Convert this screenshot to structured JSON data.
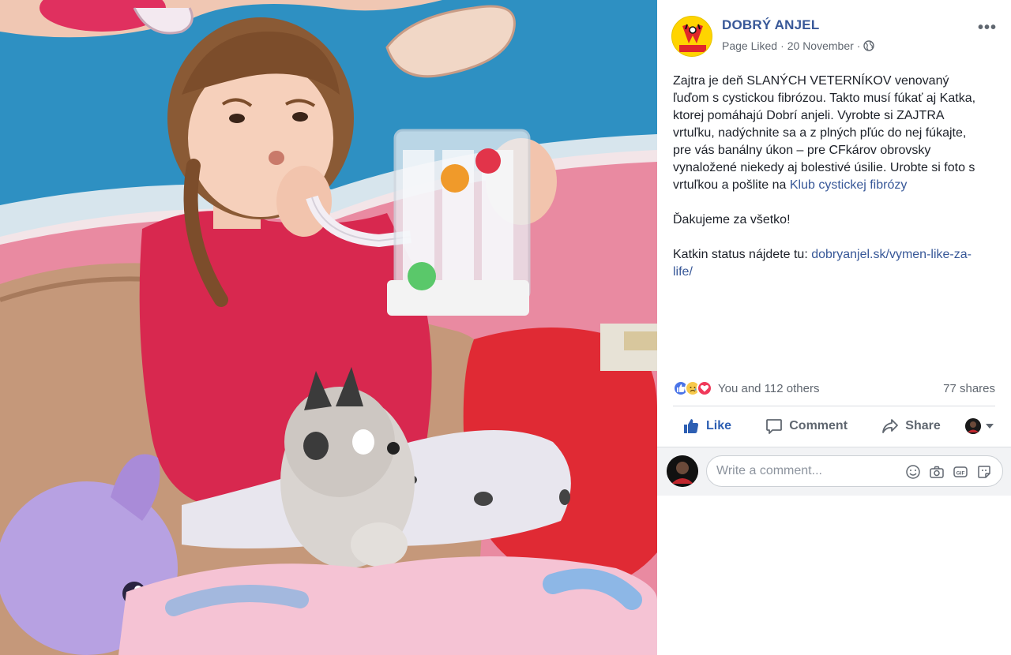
{
  "post": {
    "page_name": "DOBRÝ ANJEL",
    "page_logo_text": "DOBRÝ ANJEL",
    "status": "Page Liked",
    "separator": "·",
    "date": "20 November",
    "more_label": "•••",
    "paragraphs": [
      {
        "text": "Zajtra je deň SLANÝCH VETERNÍKOV venovaný ľuďom s cystickou fibrózou. Takto musí fúkať aj Katka, ktorej pomáhajú Dobrí anjeli. Vyrobte si ZAJTRA vrtuľku, nadýchnite sa a z plných pľúc do nej fúkajte, pre vás banálny úkon – pre CFkárov obrovsky vynaložené niekedy aj bolestivé úsilie. Urobte si foto s vrtuľkou a pošlite na ",
        "link": "Klub cystickej fibrózy"
      },
      {
        "text": "Ďakujeme za všetko!"
      },
      {
        "text": "Katkin status nájdete tu: ",
        "link": "dobryanjel.sk/vymen-like-za-life/"
      }
    ]
  },
  "reactions": {
    "icons": [
      "like-reaction-icon",
      "sad-reaction-icon",
      "love-reaction-icon"
    ],
    "count_text": "You and 112 others",
    "shares_text": "77 shares"
  },
  "actions": {
    "like": "Like",
    "comment": "Comment",
    "share": "Share"
  },
  "comment": {
    "placeholder": "Write a comment...",
    "tools": [
      "emoji-icon",
      "camera-icon",
      "gif-icon",
      "sticker-icon"
    ]
  },
  "colors": {
    "link": "#385898",
    "like_active": "#2d5fb3",
    "meta_text": "#606770",
    "comment_bg": "#f2f3f5"
  }
}
